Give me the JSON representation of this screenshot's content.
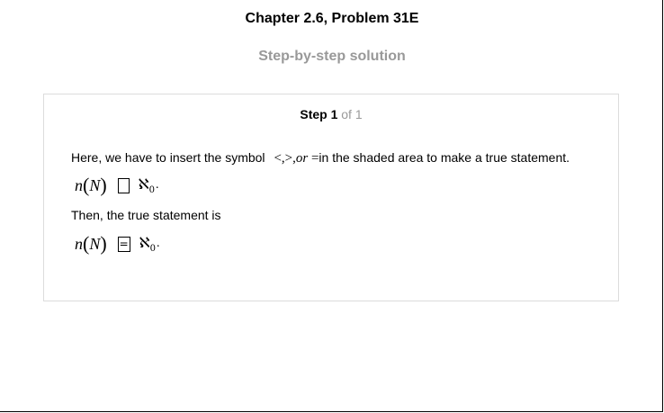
{
  "header": {
    "chapter_title": "Chapter 2.6, Problem 31E",
    "subtitle": "Step-by-step solution"
  },
  "step": {
    "label": "Step 1",
    "of_text": "of 1"
  },
  "content": {
    "intro_text": "Here, we have to insert the symbol",
    "symbols_text": "<,>,",
    "or_text": "or",
    "equals_text": "=",
    "intro_tail": "in the shaded area to make a true statement.",
    "expr_n": "n",
    "expr_N": "N",
    "expr_aleph": "ℵ",
    "expr_aleph_sub": "0",
    "expr_period": ".",
    "then_text": "Then, the true statement is",
    "answer_symbol": "="
  }
}
